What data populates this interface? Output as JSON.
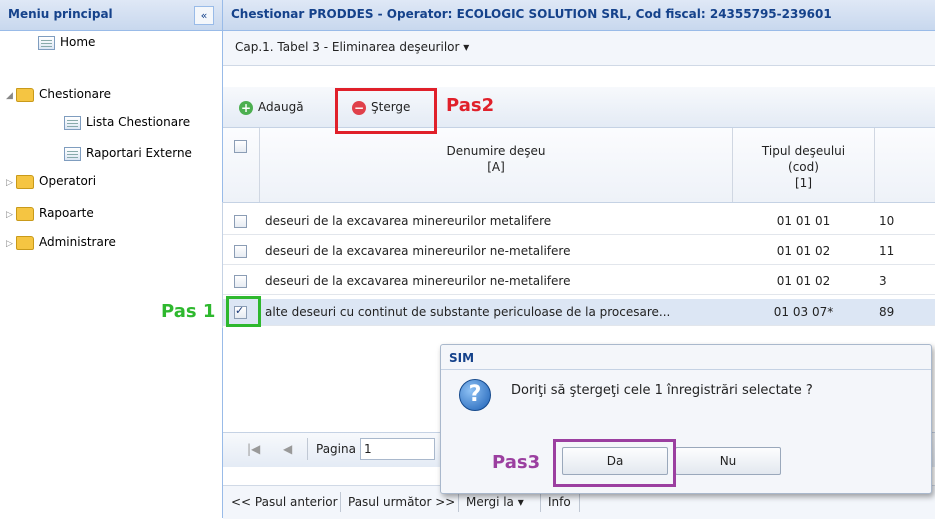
{
  "sidebar": {
    "title": "Meniu principal",
    "collapse_icon": "«",
    "items": [
      {
        "label": "Home",
        "icon": "grid-icon"
      },
      {
        "label": "Chestionare",
        "icon": "folder-icon",
        "expanded": true
      },
      {
        "label": "Lista Chestionare",
        "icon": "grid-icon"
      },
      {
        "label": "Raportari Externe",
        "icon": "grid-icon"
      },
      {
        "label": "Operatori",
        "icon": "folder-icon"
      },
      {
        "label": "Rapoarte",
        "icon": "folder-icon"
      },
      {
        "label": "Administrare",
        "icon": "folder-icon"
      }
    ]
  },
  "main": {
    "title": "Chestionar PRODDES - Operator: ECOLOGIC SOLUTION SRL, Cod fiscal: 24355795-239601",
    "tab_label": "Cap.1. Tabel 3 - Eliminarea deşeurilor ▾",
    "toolbar": {
      "add_label": "Adaugă",
      "delete_label": "Şterge"
    },
    "grid": {
      "columns": [
        {
          "header": "Denumire deşeu",
          "sub": "[A]"
        },
        {
          "header": "Tipul deşeului",
          "header2": "(cod)",
          "sub": "[1]"
        }
      ],
      "rows": [
        {
          "name": "deseuri de la excavarea minereurilor metalifere",
          "code": "01 01 01",
          "qty": "10",
          "checked": false
        },
        {
          "name": "deseuri de la excavarea minereurilor ne-metalifere",
          "code": "01 01 02",
          "qty": "11",
          "checked": false
        },
        {
          "name": "deseuri de la excavarea minereurilor ne-metalifere",
          "code": "01 01 02",
          "qty": "3",
          "checked": false
        },
        {
          "name": "alte deseuri cu continut de substante periculoase de la procesare...",
          "code": "01 03 07*",
          "qty": "89",
          "checked": true
        }
      ]
    },
    "pager": {
      "page_label": "Pagina",
      "page_value": "1"
    },
    "bottom_nav": {
      "prev": "<< Pasul anterior",
      "next": "Pasul următor >>",
      "goto": "Mergi la ▾",
      "info": "Info"
    }
  },
  "dialog": {
    "title": "SIM",
    "message": "Doriţi să ştergeţi cele 1 înregistrări selectate ?",
    "yes": "Da",
    "no": "Nu"
  },
  "annotations": {
    "step1": "Pas 1",
    "step2": "Pas2",
    "step3": "Pas3",
    "colors": {
      "step1": "#2eb82e",
      "step2": "#e0202a",
      "step3": "#9b3fa0"
    }
  }
}
